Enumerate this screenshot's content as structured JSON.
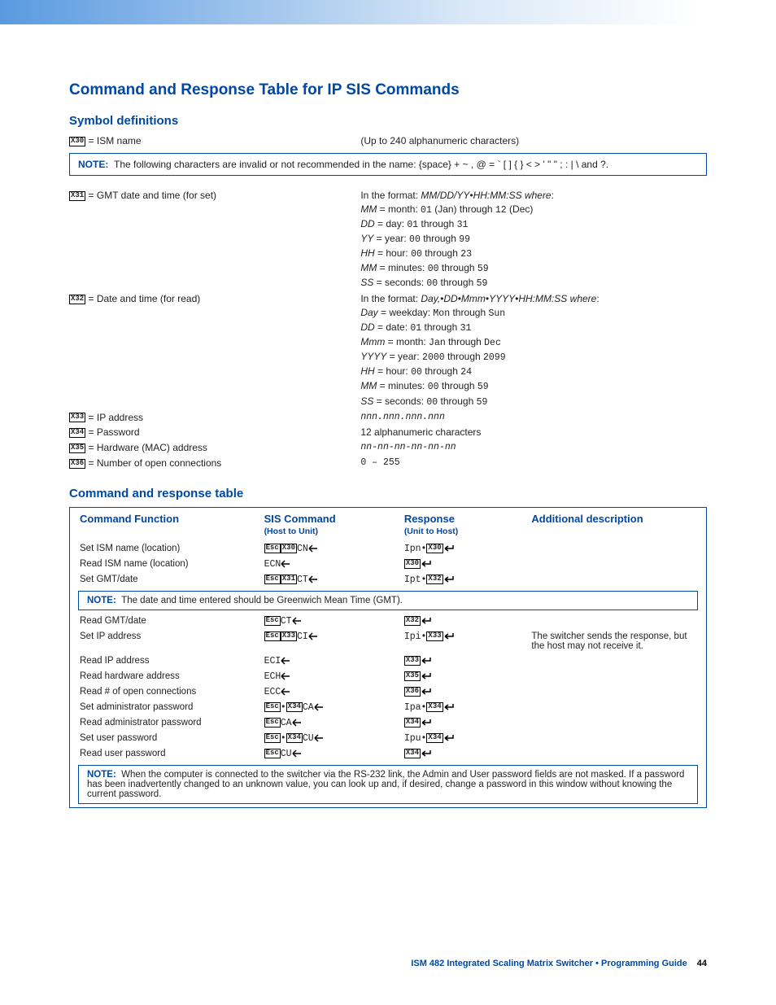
{
  "headings": {
    "main": "Command and Response Table for IP SIS Commands",
    "symbol": "Symbol definitions",
    "cmdresp": "Command and response table"
  },
  "symbols": {
    "x30_left": " = ISM name",
    "x30_right": "(Up to 240 alphanumeric characters)",
    "note1_label": "NOTE:",
    "note1": "The following characters are invalid or not recommended in the name: {space}  + ~ , @ = ` [ ] { } < > ' \" \" ; : | \\ and ?.",
    "x31_left": " = GMT date and time (for set)",
    "x31_r1": "In the format: ",
    "x31_r1b": "MM/DD/YY•HH:MM:SS where",
    "x31_r2a": "MM",
    "x31_r2b": " = month: ",
    "x31_r2c": "01",
    "x31_r2d": " (Jan) through ",
    "x31_r2e": "12",
    "x31_r2f": " (Dec)",
    "x31_r3a": "DD",
    "x31_r3b": " = day: ",
    "x31_r3c": "01",
    "x31_r3d": " through ",
    "x31_r3e": "31",
    "x31_r4a": "YY",
    "x31_r4b": " = year: ",
    "x31_r4c": "00",
    "x31_r4d": " through ",
    "x31_r4e": "99",
    "x31_r5a": "HH",
    "x31_r5b": " = hour: ",
    "x31_r5c": "00",
    "x31_r5d": " through ",
    "x31_r5e": "23",
    "x31_r6a": "MM",
    "x31_r6b": " = minutes: ",
    "x31_r6c": "00",
    "x31_r6d": " through ",
    "x31_r6e": "59",
    "x31_r7a": "SS",
    "x31_r7b": " = seconds: ",
    "x31_r7c": "00",
    "x31_r7d": " through ",
    "x31_r7e": "59",
    "x32_left": " = Date and time (for read)",
    "x32_r1": "In the format: ",
    "x32_r1b": "Day,•DD•Mmm•YYYY•HH:MM:SS where",
    "x32_r2a": "Day",
    "x32_r2b": " = weekday: ",
    "x32_r2c": "Mon",
    "x32_r2d": " through ",
    "x32_r2e": "Sun",
    "x32_r3a": "DD",
    "x32_r3b": " = date: ",
    "x32_r3c": "01",
    "x32_r3d": " through ",
    "x32_r3e": "31",
    "x32_r4a": "Mmm",
    "x32_r4b": " = month: ",
    "x32_r4c": "Jan",
    "x32_r4d": " through ",
    "x32_r4e": "Dec",
    "x32_r5a": "YYYY",
    "x32_r5b": " = year: ",
    "x32_r5c": "2000",
    "x32_r5d": " through ",
    "x32_r5e": "2099",
    "x32_r6a": "HH",
    "x32_r6b": " = hour: ",
    "x32_r6c": "00",
    "x32_r6d": " through ",
    "x32_r6e": "24",
    "x32_r7a": "MM",
    "x32_r7b": " = minutes: ",
    "x32_r7c": "00",
    "x32_r7d": " through ",
    "x32_r7e": "59",
    "x32_r8a": "SS",
    "x32_r8b": " = seconds: ",
    "x32_r8c": "00",
    "x32_r8d": " through ",
    "x32_r8e": "59",
    "x33_left": " = IP address",
    "x33_right": "nnn.nnn.nnn.nnn",
    "x34_left": " = Password",
    "x34_right": "12 alphanumeric characters",
    "x35_left": " = Hardware (MAC) address",
    "x35_right": "nn-nn-nn-nn-nn-nn",
    "x36_left": " = Number of open connections",
    "x36_right": "0 – 255"
  },
  "table": {
    "h1": "Command Function",
    "h2": "SIS Command",
    "h2s": "(Host to Unit)",
    "h3": "Response",
    "h3s": "(Unit to Host)",
    "h4": "Additional description",
    "r1": {
      "fn": "Set ISM name (location)",
      "cmd_text": "CN",
      "cmd_x": "X30",
      "resp_pre": "Ipn•",
      "resp_x": "X30"
    },
    "r2": {
      "fn": "Read ISM name (location)",
      "cmd_text": "ECN",
      "resp_x": "X30"
    },
    "r3": {
      "fn": "Set GMT/date",
      "cmd_text": "CT",
      "cmd_x": "X31",
      "resp_pre": "Ipt•",
      "resp_x": "X32"
    },
    "note2_label": "NOTE:",
    "note2": "The date and time entered should be Greenwich Mean Time (GMT).",
    "r4": {
      "fn": "Read GMT/date",
      "cmd_text": "CT",
      "resp_x": "X32"
    },
    "r5": {
      "fn": "Set IP address",
      "cmd_text": "CI",
      "cmd_x": "X33",
      "resp_pre": "Ipi•",
      "resp_x": "X33",
      "desc": "The switcher sends the response, but the host may not receive it."
    },
    "r6": {
      "fn": "Read IP address",
      "cmd_text": "ECI",
      "resp_x": "X33"
    },
    "r7": {
      "fn": "Read hardware address",
      "cmd_text": "ECH",
      "resp_x": "X35"
    },
    "r8": {
      "fn": "Read # of open connections",
      "cmd_text": "ECC",
      "resp_x": "X36"
    },
    "r9": {
      "fn": "Set administrator password",
      "cmd_text": "CA",
      "cmd_x": "X34",
      "cmd_prefix": "•",
      "resp_pre": "Ipa•",
      "resp_x": "X34"
    },
    "r10": {
      "fn": "Read administrator password",
      "cmd_text": "CA",
      "resp_x": "X34"
    },
    "r11": {
      "fn": "Set user password",
      "cmd_text": "CU",
      "cmd_x": "X34",
      "cmd_prefix": "•",
      "resp_pre": "Ipu•",
      "resp_x": "X34"
    },
    "r12": {
      "fn": "Read user password",
      "cmd_text": "CU",
      "resp_x": "X34"
    },
    "note3_label": "NOTE:",
    "note3": "When the computer is connected to the switcher via the RS-232 link, the Admin and User password fields are not masked.  If a password has been inadvertently changed to an unknown value, you can look up and, if desired, change a password in this window without knowing the current password."
  },
  "footer": {
    "title": "ISM 482 Integrated Scaling Matrix Switcher • Programming Guide",
    "page": "44"
  }
}
